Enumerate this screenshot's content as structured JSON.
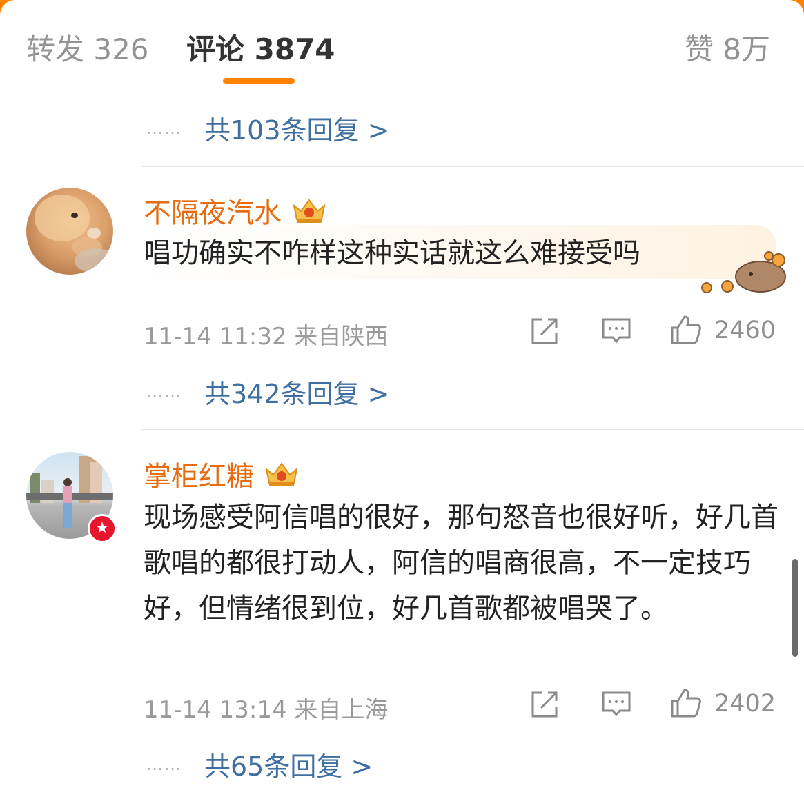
{
  "tabs": {
    "repost": "转发 326",
    "comment": "评论 3874",
    "like": "赞 8万"
  },
  "colors": {
    "accent": "#ff8200",
    "link": "#3f6ea0",
    "username": "#e86b0e"
  },
  "reply_top": {
    "dots": "……",
    "text": "共103条回复 >"
  },
  "comments": [
    {
      "username": "不隔夜汽水",
      "text": "唱功确实不咋样这种实话就这么难接受吗",
      "time": "11-14 11:32 来自陕西",
      "likes": "2460",
      "replies": "共342条回复 >"
    },
    {
      "username": "掌柜红糖",
      "text": "现场感受阿信唱的很好，那句怒音也很好听，好几首歌唱的都很打动人，阿信的唱商很高，不一定技巧好，但情绪很到位，好几首歌都被唱哭了。",
      "time": "11-14 13:14 来自上海",
      "likes": "2402",
      "replies": "共65条回复 >"
    }
  ]
}
